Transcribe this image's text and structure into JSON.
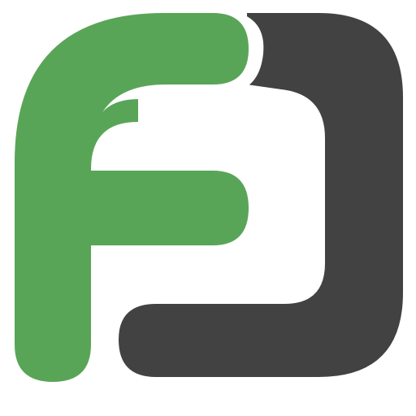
{
  "logo": {
    "letters": "FD",
    "colors": {
      "background": "#ffffff",
      "f_green": "#59a557",
      "d_dark": "#424242",
      "separator": "#ffffff"
    }
  }
}
